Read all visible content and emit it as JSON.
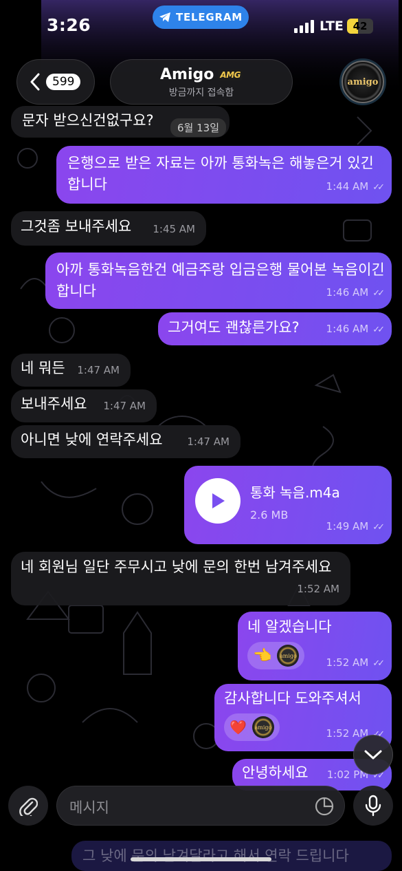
{
  "status_bar": {
    "time": "3:26",
    "app_pill": "TELEGRAM",
    "network": "LTE",
    "battery": "42",
    "battery_level": 0.42
  },
  "header": {
    "back_count": "599",
    "chat_name": "Amigo",
    "badge": "AMG",
    "status": "방금까지 접속함",
    "avatar_text": "amigo"
  },
  "date_chip": "6월 13일",
  "messages": [
    {
      "text": "문자 받으신건없구요?",
      "time": ""
    },
    {
      "text": "은행으로 받은 자료는 아까 통화녹은 해놓은거 있긴 합니다",
      "time": "1:44 AM"
    },
    {
      "text": "그것좀 보내주세요",
      "time": "1:45 AM"
    },
    {
      "text": "아까 통화녹음한건 예금주랑 입금은행 물어본 녹음이긴 합니다",
      "time": "1:46 AM"
    },
    {
      "text": "그거여도 괜찮른가요?",
      "time": "1:46 AM"
    },
    {
      "text": "네 뭐든",
      "time": "1:47 AM"
    },
    {
      "text": "보내주세요",
      "time": "1:47 AM"
    },
    {
      "text": "아니면 낮에 연락주세요",
      "time": "1:47 AM"
    },
    {
      "file_name": "통화 녹음.m4a",
      "file_size": "2.6 MB",
      "time": "1:49 AM"
    },
    {
      "text": "네 회원님 일단 주무시고 낮에 문의 한번 남겨주세요",
      "time": "1:52 AM"
    },
    {
      "text": "네 알겠습니다",
      "time": "1:52 AM",
      "reaction": "👈",
      "reaction_sticker": "amigo"
    },
    {
      "text": "감사합니다 도와주셔서",
      "time": "1:52 AM",
      "reaction": "❤️",
      "reaction_sticker": "amigo"
    },
    {
      "text": "안녕하세요",
      "time": "1:02 PM"
    }
  ],
  "faded_bottom": "그 낮에 문의 남겨달라고 해서 연락 드립니다",
  "input": {
    "placeholder": "메시지"
  },
  "icons": {
    "back": "chevron-left-icon",
    "attach": "paperclip-icon",
    "sticker": "sticker-icon",
    "mic": "microphone-icon",
    "scroll": "chevron-down-icon",
    "play": "play-icon",
    "telegram": "telegram-icon"
  }
}
